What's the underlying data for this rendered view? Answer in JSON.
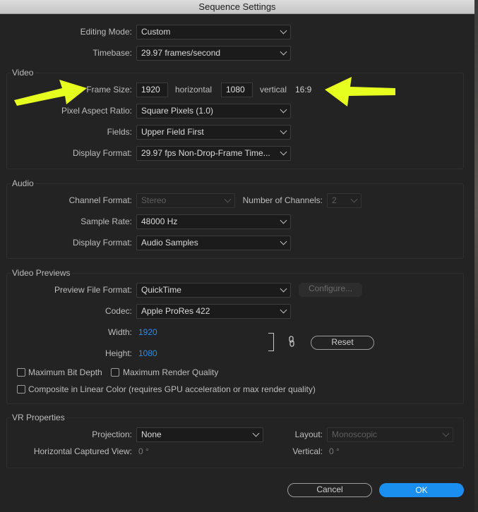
{
  "window": {
    "title": "Sequence Settings"
  },
  "general": {
    "editing_mode_label": "Editing Mode:",
    "editing_mode_value": "Custom",
    "timebase_label": "Timebase:",
    "timebase_value": "29.97  frames/second"
  },
  "video": {
    "group_label": "Video",
    "frame_size_label": "Frame Size:",
    "horizontal_value": "1920",
    "horizontal_label": "horizontal",
    "vertical_value": "1080",
    "vertical_label": "vertical",
    "aspect": "16:9",
    "par_label": "Pixel Aspect Ratio:",
    "par_value": "Square Pixels (1.0)",
    "fields_label": "Fields:",
    "fields_value": "Upper Field First",
    "display_format_label": "Display Format:",
    "display_format_value": "29.97 fps Non-Drop-Frame Time..."
  },
  "audio": {
    "group_label": "Audio",
    "channel_format_label": "Channel Format:",
    "channel_format_value": "Stereo",
    "num_channels_label": "Number of Channels:",
    "num_channels_value": "2",
    "sample_rate_label": "Sample Rate:",
    "sample_rate_value": "48000 Hz",
    "display_format_label": "Display Format:",
    "display_format_value": "Audio Samples"
  },
  "previews": {
    "group_label": "Video Previews",
    "file_format_label": "Preview File Format:",
    "file_format_value": "QuickTime",
    "configure_label": "Configure...",
    "codec_label": "Codec:",
    "codec_value": "Apple ProRes 422",
    "width_label": "Width:",
    "width_value": "1920",
    "height_label": "Height:",
    "height_value": "1080",
    "reset_label": "Reset",
    "max_bit_depth_label": "Maximum Bit Depth",
    "max_render_quality_label": "Maximum Render Quality",
    "linear_color_label": "Composite in Linear Color (requires GPU acceleration or max render quality)"
  },
  "vr": {
    "group_label": "VR Properties",
    "projection_label": "Projection:",
    "projection_value": "None",
    "layout_label": "Layout:",
    "layout_value": "Monoscopic",
    "hcv_label": "Horizontal Captured View:",
    "hcv_value": "0 °",
    "vertical_label": "Vertical:",
    "vertical_value": "0 °"
  },
  "footer": {
    "cancel_label": "Cancel",
    "ok_label": "OK"
  },
  "colors": {
    "accent": "#1b8ff0",
    "annotation_arrow": "#e6ff1e",
    "link_value": "#2d8ceb"
  }
}
